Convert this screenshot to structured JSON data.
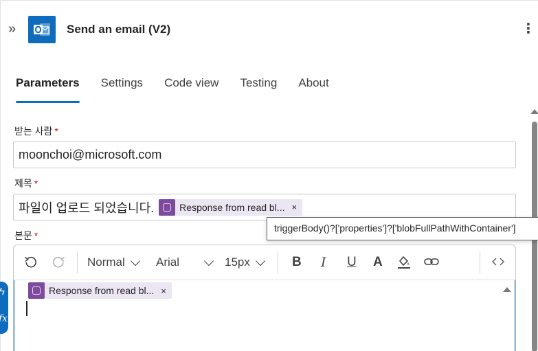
{
  "header": {
    "title": "Send an email (V2)",
    "collapse_icon": "double-chevron-right-icon",
    "app_icon": "outlook-icon",
    "more_icon": "more-vertical-icon"
  },
  "tabs": [
    {
      "label": "Parameters",
      "active": true
    },
    {
      "label": "Settings",
      "active": false
    },
    {
      "label": "Code view",
      "active": false
    },
    {
      "label": "Testing",
      "active": false
    },
    {
      "label": "About",
      "active": false
    }
  ],
  "form": {
    "to": {
      "label": "받는 사람",
      "required": "*",
      "value": "moonchoi@microsoft.com"
    },
    "subject": {
      "label": "제목",
      "required": "*",
      "text": "파일이 업로드 되었습니다.",
      "token": {
        "label": "Response from read bl...",
        "remove": "×"
      }
    },
    "body": {
      "label": "본문",
      "required": "*",
      "token": {
        "label": "Response from read bl...",
        "remove": "×"
      }
    }
  },
  "tooltip": {
    "text": "triggerBody()?['properties']?['blobFullPathWithContainer']"
  },
  "toolbar": {
    "undo_icon": "undo-icon",
    "redo_icon": "redo-icon",
    "style_select": "Normal",
    "font_select": "Arial",
    "size_select": "15px",
    "bold": "B",
    "italic": "I",
    "underline": "U",
    "font_color": "A",
    "highlight_icon": "paint-bucket-icon",
    "link_icon": "link-icon",
    "code_icon": "code-view-icon"
  },
  "side_pill": {
    "bolt_icon": "lightning-icon",
    "fx_label": "fx"
  },
  "colors": {
    "accent": "#0f6cbd",
    "token_bg": "#ece6f3",
    "token_icon": "#7e4a9e",
    "required": "#c50f1f"
  }
}
